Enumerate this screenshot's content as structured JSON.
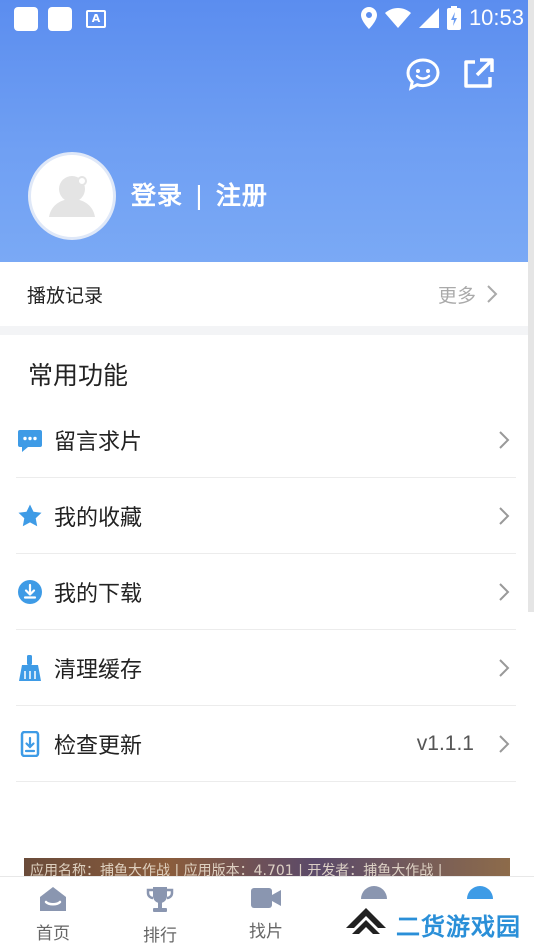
{
  "status_bar": {
    "time": "10:53"
  },
  "profile": {
    "login_label": "登录",
    "separator": "|",
    "register_label": "注册"
  },
  "history": {
    "title": "播放记录",
    "more_label": "更多"
  },
  "section": {
    "title": "常用功能"
  },
  "menu": [
    {
      "label": "留言求片",
      "icon": "message-icon",
      "value": ""
    },
    {
      "label": "我的收藏",
      "icon": "star-icon",
      "value": ""
    },
    {
      "label": "我的下载",
      "icon": "download-icon",
      "value": ""
    },
    {
      "label": "清理缓存",
      "icon": "broom-icon",
      "value": ""
    },
    {
      "label": "检查更新",
      "icon": "update-icon",
      "value": "v1.1.1"
    }
  ],
  "banner": {
    "text": "应用名称：捕鱼大作战 | 应用版本：4.701 | 开发者：捕鱼大作战 |"
  },
  "tabs": [
    {
      "label": "首页",
      "icon": "home-icon"
    },
    {
      "label": "排行",
      "icon": "trophy-icon"
    },
    {
      "label": "找片",
      "icon": "video-camera-icon"
    }
  ],
  "watermark": {
    "text": "二货游戏园"
  },
  "colors": {
    "header_top": "#5b8def",
    "header_bottom": "#7aa9f5",
    "icon_blue": "#3e9be6",
    "watermark": "#2a8fd8"
  }
}
